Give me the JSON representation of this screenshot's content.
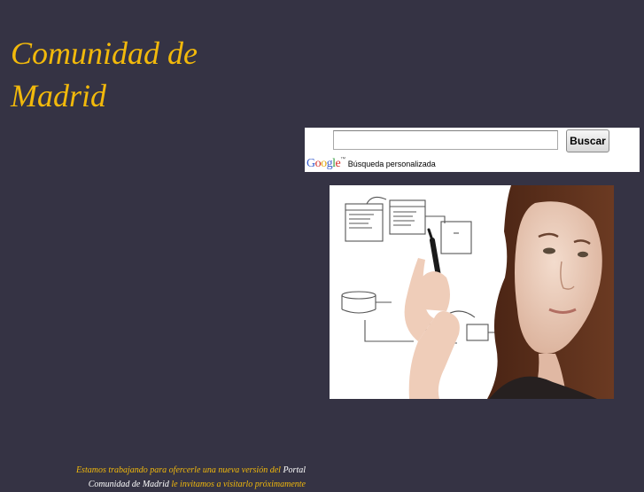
{
  "site": {
    "title": "Comunidad de Madrid"
  },
  "search": {
    "input_value": "",
    "button_label": "Buscar",
    "brand_letters": [
      "G",
      "o",
      "o",
      "g",
      "l",
      "e"
    ],
    "brand_mark": "™",
    "label": "Búsqueda personalizada"
  },
  "footer": {
    "text_before_link": "Estamos trabajando para ofercerle una nueva versión del ",
    "link_text": "Portal Comunidad de Madrid",
    "text_after_link": " le invitamos a visitarlo próximamente"
  },
  "colors": {
    "background": "#353344",
    "title": "#f2b90b",
    "link": "#ffffff"
  }
}
